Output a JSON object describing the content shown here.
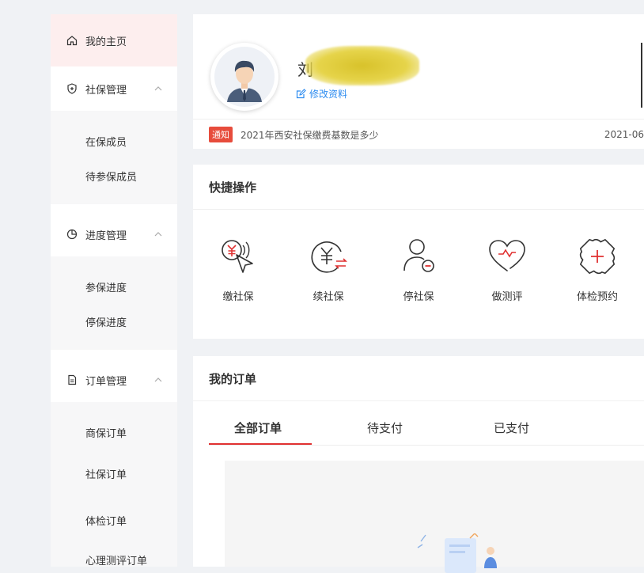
{
  "sidebar": {
    "home": "我的主页",
    "groups": [
      {
        "title": "社保管理",
        "items": [
          "在保成员",
          "待参保成员"
        ]
      },
      {
        "title": "进度管理",
        "items": [
          "参保进度",
          "停保进度"
        ]
      },
      {
        "title": "订单管理",
        "items": [
          "商保订单",
          "社保订单",
          "体检订单",
          "心理测评订单"
        ]
      }
    ]
  },
  "profile": {
    "name_visible": "刘",
    "edit_label": "修改资料",
    "notice_badge": "通知",
    "notice_text": "2021年西安社保缴费基数是多少",
    "notice_date": "2021-06"
  },
  "quick_actions": {
    "title": "快捷操作",
    "items": [
      {
        "label": "缴社保",
        "icon": "yuan-cursor-icon"
      },
      {
        "label": "续社保",
        "icon": "yuan-exchange-icon"
      },
      {
        "label": "停社保",
        "icon": "user-minus-icon"
      },
      {
        "label": "做测评",
        "icon": "heart-pulse-icon"
      },
      {
        "label": "体检预约",
        "icon": "medical-cross-icon"
      }
    ]
  },
  "orders": {
    "title": "我的订单",
    "tabs": [
      "全部订单",
      "待支付",
      "已支付"
    ]
  },
  "colors": {
    "accent": "#e03131",
    "link": "#2d8cf0",
    "home_bg": "#fdeeee"
  }
}
